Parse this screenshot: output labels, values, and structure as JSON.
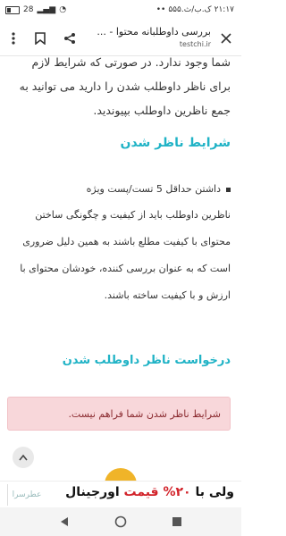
{
  "status_bar": {
    "time": "۲۱:۱۷",
    "carrier_info": "۵۵۵.ک.ب/ث",
    "battery": "28"
  },
  "browser": {
    "page_title": "بررسی داوطلبانه محتوا - ...",
    "host": "testchi.ir"
  },
  "article": {
    "intro_text": "شما وجود ندارد. در صورتی که شرایط لازم برای ناظر داوطلب شدن را دارید می توانید به جمع ناظرین داوطلب بپیوندید.",
    "section1_title": "شرایط ناظر شدن",
    "bullet_first": "داشتن حداقل 5 تست/پست ویژه",
    "bullet_paragraph": "ناظرین داوطلب باید از کیفیت و چگونگی ساختن محتوای با کیفیت مطلع باشند به همین دلیل ضروری است که به عنوان بررسی کننده، خودشان محتوای با ارزش و با کیفیت ساخته باشند.",
    "section2_title": "درخواست ناظر داوطلب شدن",
    "alert_text": "شرایط ناظر شدن شما فراهم نیست."
  },
  "ad": {
    "text_start": "ولی با",
    "percent": "۲۰%",
    "text_mid": "قیمت",
    "text_end": "اورجینال",
    "logo_text": "عطرسرا"
  },
  "colors": {
    "accent": "#20b3c6",
    "alert_bg": "#f8d7da",
    "alert_text": "#8a2a2f",
    "ad_red": "#d2232a"
  }
}
